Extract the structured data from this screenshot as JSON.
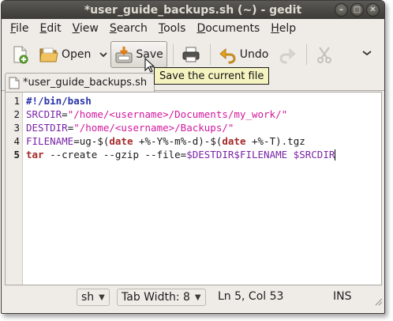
{
  "window": {
    "title": "*user_guide_backups.sh (~) - gedit",
    "buttons": [
      "–",
      "□",
      "✕"
    ]
  },
  "menubar": {
    "items": [
      {
        "mnemonic": "F",
        "rest": "ile"
      },
      {
        "mnemonic": "E",
        "rest": "dit"
      },
      {
        "mnemonic": "V",
        "rest": "iew"
      },
      {
        "mnemonic": "S",
        "rest": "earch"
      },
      {
        "mnemonic": "T",
        "rest": "ools"
      },
      {
        "mnemonic": "D",
        "rest": "ocuments"
      },
      {
        "mnemonic": "H",
        "rest": "elp"
      }
    ]
  },
  "toolbar": {
    "open_label": "Open",
    "save_label": "Save",
    "undo_label": "Undo"
  },
  "tab": {
    "label": "*user_guide_backups.sh"
  },
  "tooltip": {
    "text": "Save the current file"
  },
  "editor": {
    "line_numbers": [
      "1",
      "2",
      "3",
      "4",
      "5"
    ],
    "line1": {
      "shebang": "#!/bin/bash"
    },
    "line2": {
      "var": "SRCDIR",
      "eq": "=",
      "value": "\"/home/<username>/Documents/my_work/\""
    },
    "line3": {
      "var": "DESTDIR",
      "eq": "=",
      "value": "\"/home/<username>/Backups/\""
    },
    "line4": {
      "var": "FILENAME",
      "eq": "=ug-$(",
      "kw1": "date",
      "mid": " +%-Y%-m%-d)-$(",
      "kw2": "date",
      "end": " +%-T).tgz"
    },
    "line5": {
      "cmd": "tar",
      "args": " --create --gzip --file=",
      "v1": "$DESTDIR",
      "v2": "$FILENAME",
      "sp": " ",
      "v3": "$SRCDIR"
    }
  },
  "statusbar": {
    "language": "sh",
    "tab_width": "Tab Width:  8",
    "position": "Ln 5, Col 53",
    "mode": "INS"
  },
  "colors": {
    "keyword": "#2a34a8",
    "string": "#d1189c",
    "variable": "#7a25a6",
    "titlebar": "#3c3b37"
  }
}
